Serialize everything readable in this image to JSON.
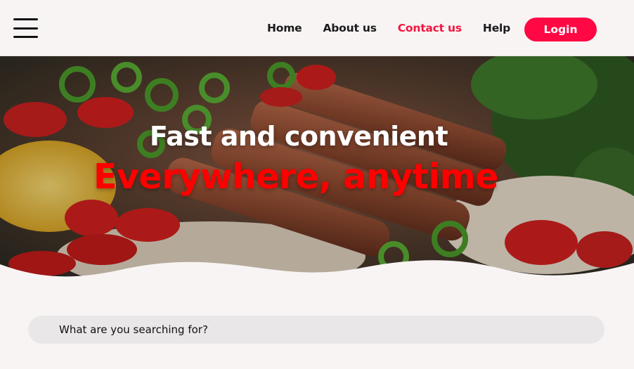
{
  "header": {
    "menu_icon": "hamburger-menu-icon",
    "nav": {
      "home": "Home",
      "about": "About us",
      "contact": "Contact us",
      "help": "Help"
    },
    "active_nav": "contact",
    "login_label": "Login"
  },
  "hero": {
    "title": "Fast and convenient",
    "subtitle": "Everywhere, anytime"
  },
  "search": {
    "placeholder": "What are you searching for?"
  },
  "colors": {
    "accent": "#ff0844",
    "active_link": "#f0163f",
    "subtitle": "#ff0000",
    "background": "#f8f4f4"
  }
}
